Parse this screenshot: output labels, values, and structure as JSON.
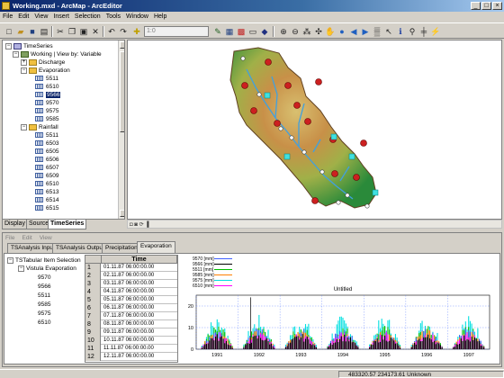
{
  "window": {
    "title": "Working.mxd - ArcMap - ArcEditor",
    "min": "_",
    "max": "□",
    "close": "×"
  },
  "menu": [
    "File",
    "Edit",
    "View",
    "Insert",
    "Selection",
    "Tools",
    "Window",
    "Help"
  ],
  "toolbar": {
    "scale": "1:0"
  },
  "toc": {
    "root": "TimeSeries",
    "view": "Working | View by: Variable",
    "groups": [
      {
        "label": "Discharge",
        "expanded": false,
        "items": []
      },
      {
        "label": "Evaporation",
        "expanded": true,
        "items": [
          "5511",
          "6510",
          "9566",
          "9570",
          "9575",
          "9585"
        ],
        "selected": "9566"
      },
      {
        "label": "Rainfall",
        "expanded": true,
        "items": [
          "5511",
          "6503",
          "6505",
          "6506",
          "6507",
          "6509",
          "6510",
          "6513",
          "6514",
          "6515"
        ]
      }
    ],
    "tabs": [
      "Display",
      "Source",
      "TimeSeries"
    ],
    "active_tab": "TimeSeries"
  },
  "ts": {
    "menu": [
      "File",
      "Edit",
      "View"
    ],
    "tabs": [
      "TSAnalysis Input",
      "TSAnalysis Output",
      "Precipitation",
      "Evaporation"
    ],
    "active_tab": "Evaporation",
    "tree": {
      "root": "TSTabular Item Selection",
      "group": "Vistula Evaporation",
      "items": [
        "9570",
        "9566",
        "5511",
        "9585",
        "9575",
        "6510"
      ]
    },
    "grid": {
      "header": "Time",
      "rows": [
        {
          "n": "1",
          "t": "01.11.87 06:00:00.00"
        },
        {
          "n": "2",
          "t": "02.11.87 06:00:00.00"
        },
        {
          "n": "3",
          "t": "03.11.87 06:00:00.00"
        },
        {
          "n": "4",
          "t": "04.11.87 06:00:00.00"
        },
        {
          "n": "5",
          "t": "05.11.87 06:00:00.00"
        },
        {
          "n": "6",
          "t": "06.11.87 06:00:00.00"
        },
        {
          "n": "7",
          "t": "07.11.87 06:00:00.00"
        },
        {
          "n": "8",
          "t": "08.11.87 06:00:00.00"
        },
        {
          "n": "9",
          "t": "09.11.87 06:00:00.00"
        },
        {
          "n": "10",
          "t": "10.11.87 06:00:00.00"
        },
        {
          "n": "11",
          "t": "11.11.87 06:00:00.00"
        },
        {
          "n": "12",
          "t": "12.11.87 06:00:00.00"
        }
      ]
    }
  },
  "chart_data": {
    "type": "area",
    "title": "Untitled",
    "xlabel": "",
    "ylabel": "",
    "categories": [
      "1991",
      "1992",
      "1993",
      "1994",
      "1995",
      "1996",
      "1997"
    ],
    "ylim": [
      0,
      25
    ],
    "yticks": [
      "0",
      "10",
      "20"
    ],
    "legend_position": "top-left",
    "series": [
      {
        "name": "9570 [mm]",
        "color": "#4060ff"
      },
      {
        "name": "9566 [mm]",
        "color": "#000000"
      },
      {
        "name": "5511 [mm]",
        "color": "#00c000"
      },
      {
        "name": "9585 [mm]",
        "color": "#ff8000"
      },
      {
        "name": "9575 [mm]",
        "color": "#00e0e0"
      },
      {
        "name": "6510 [mm]",
        "color": "#ff00ff"
      }
    ]
  },
  "status": {
    "coords": "483320.57  234173.61 Unknown"
  }
}
